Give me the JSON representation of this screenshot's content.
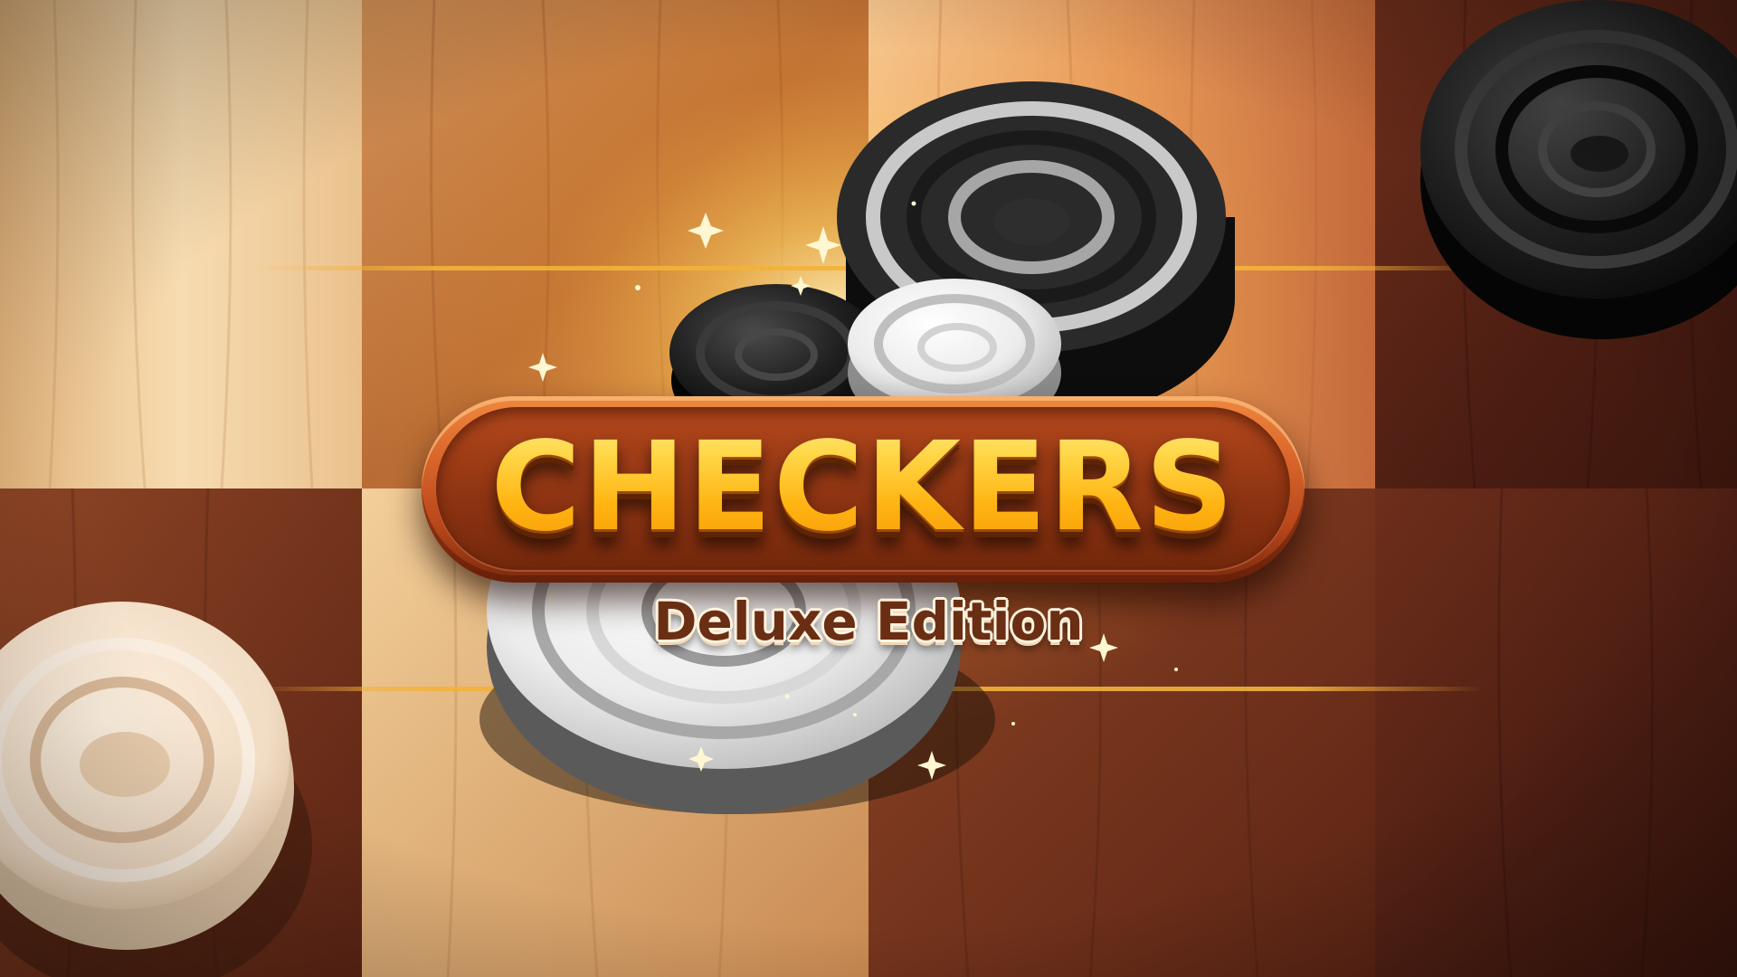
{
  "title": "CHECKERS",
  "subtitle": "Deluxe Edition",
  "colors": {
    "banner_orange": "#d8642a",
    "title_gold": "#ffc21f",
    "subtitle_brown": "#6a2e14",
    "gold_line": "#f2b23a",
    "wood_light": "#f1cf9e",
    "wood_mid": "#c0783e",
    "wood_dark": "#4a1d10"
  }
}
